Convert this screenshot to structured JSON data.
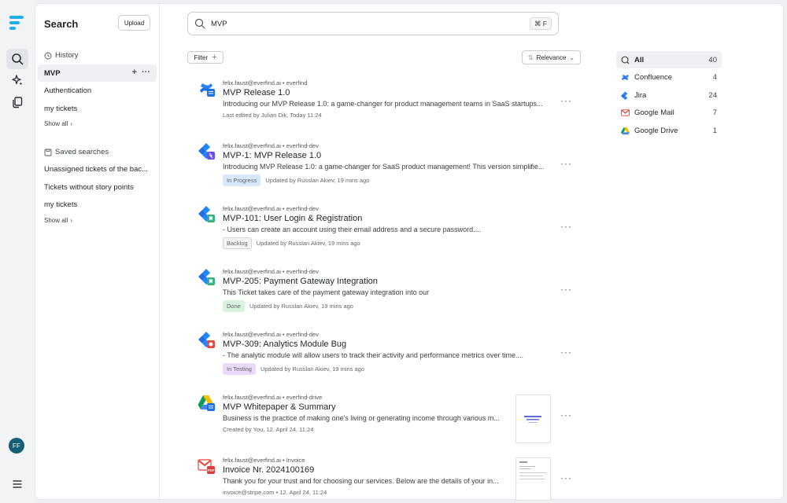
{
  "sidebar": {
    "title": "Search",
    "upload_label": "Upload",
    "history_label": "History",
    "history_items": [
      "MVP",
      "Authentication",
      "my tickets"
    ],
    "show_all_label": "Show all",
    "saved_label": "Saved searches",
    "saved_items": [
      "Unassigned tickets of the bac...",
      "Tickets without story points",
      "my tickets"
    ]
  },
  "user": {
    "initials": "FF",
    "avatar_color": "#155e75"
  },
  "search": {
    "query": "MVP",
    "shortcut": "⌘ F"
  },
  "toolbar": {
    "filter_label": "Filter",
    "sort_label": "Relevance"
  },
  "results": [
    {
      "icon": "confluence-icon",
      "meta": "felix.faust@everfind.ai • everfind",
      "title": "MVP Release 1.0",
      "snippet": "Introducing our MVP Release 1.0: a game-changer for product management teams in SaaS startups...",
      "status": "",
      "footer": "Last edited by Julian Dik, Today 11:24"
    },
    {
      "icon": "jira-icon",
      "meta": "felix.faust@everfind.ai • everfind-dev",
      "title": "MVP-1: MVP Release 1.0",
      "snippet": "Introducing MVP Release 1.0: a game-changer for SaaS product management! This version simplifie...",
      "status": "In Progress",
      "footer": "Updated by Russlan Akiev, 19 mins ago"
    },
    {
      "icon": "jira-icon",
      "meta": "felix.faust@everfind.ai • everfind-dev",
      "title": "MVP-101: User Login & Registration",
      "snippet": "- Users can create an account using their email address and a secure password....",
      "status": "Backlog",
      "footer": "Updated by Russlan Akiev, 19 mins ago"
    },
    {
      "icon": "jira-icon",
      "meta": "felix.faust@everfind.ai • everfind-dev",
      "title": "MVP-205: Payment Gateway Integration",
      "snippet": "This Ticket takes care of the payment gateway integration into our",
      "status": "Done",
      "footer": "Updated by Russlan Akiev, 19 mins ago"
    },
    {
      "icon": "jira-icon",
      "meta": "felix.faust@everfind.ai • everfind-dev",
      "title": "MVP-309: Analytics Module Bug",
      "snippet": "- The analytic module will allow users to track their activity and performance metrics over time....",
      "status": "In Testing",
      "footer": "Updated by Russlan Akiev, 19 mins ago"
    },
    {
      "icon": "google-drive-icon",
      "meta": "felix.faust@everfind.ai • everfind-drive",
      "title": "MVP Whitepaper & Summary",
      "snippet": "Business is the practice of making one's living or generating income through various m...",
      "status": "",
      "footer": "Created by You, 12. April 24, 11:24"
    },
    {
      "icon": "google-mail-icon",
      "meta": "felix.faust@everfind.ai • Invoice",
      "title": "Invoice Nr. 2024100169",
      "snippet": "Thank you for your trust and for choosing our services. Below are the details of your in...",
      "status": "",
      "footer": "invoice@stripe.com • 12. April 24, 11:24"
    }
  ],
  "facets": [
    {
      "label": "All",
      "count": "40",
      "icon": "search-all-icon"
    },
    {
      "label": "Confluence",
      "count": "4",
      "icon": "confluence-icon"
    },
    {
      "label": "Jira",
      "count": "24",
      "icon": "jira-icon"
    },
    {
      "label": "Google Mail",
      "count": "7",
      "icon": "google-mail-icon"
    },
    {
      "label": "Google Drive",
      "count": "1",
      "icon": "google-drive-icon"
    }
  ],
  "status_colors": {
    "In Progress": "#d6e8fb",
    "Backlog": "#f1f3f5",
    "Done": "#d8f3dd",
    "In Testing": "#ead9fb"
  }
}
